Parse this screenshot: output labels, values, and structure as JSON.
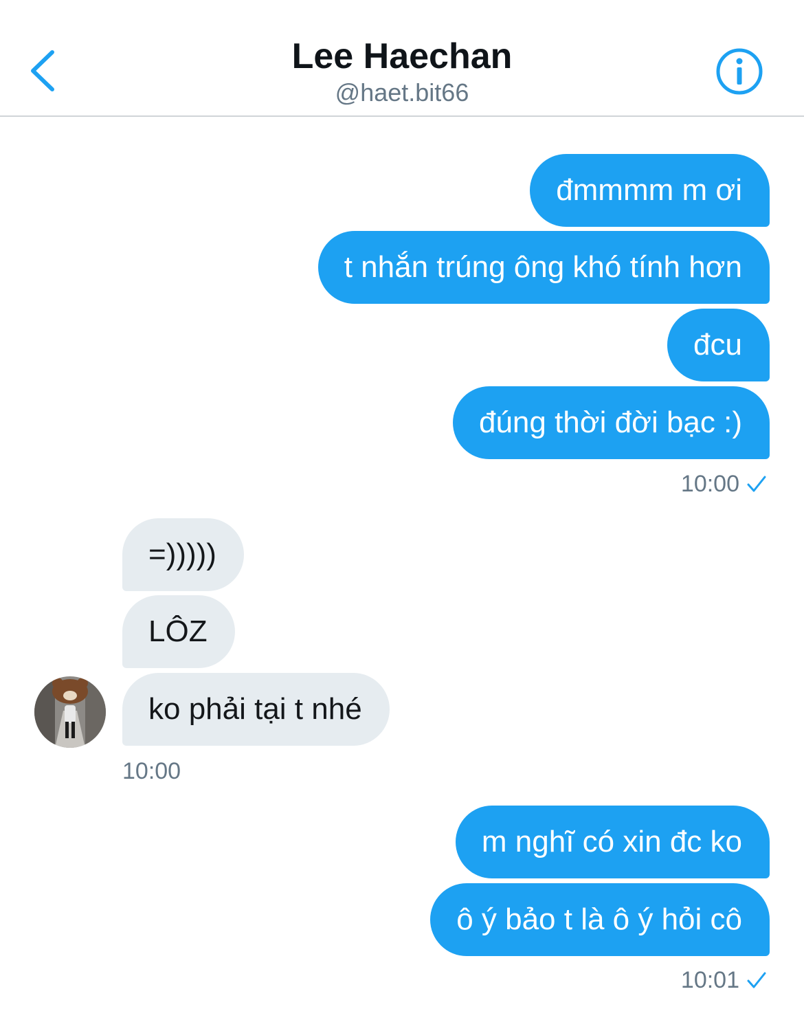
{
  "header": {
    "name": "Lee Haechan",
    "handle": "@haet.bit66",
    "back_icon": "chevron-left-icon",
    "info_icon": "info-circle-icon"
  },
  "colors": {
    "accent": "#1da1f2",
    "received_bubble": "#e6ecf0",
    "muted_text": "#657786"
  },
  "messages": {
    "group1": {
      "m1": "đmmmm m ơi",
      "m2": "t nhắn trúng ông khó tính hơn",
      "m3": "đcu",
      "m4": "đúng thời đời bạc :)",
      "time": "10:00"
    },
    "group2": {
      "m1": "=)))))",
      "m2": "LÔZ",
      "m3": "ko phải tại t nhé",
      "time": "10:00"
    },
    "group3": {
      "m1": "m nghĩ có xin đc ko",
      "m2": "ô ý bảo t là ô ý hỏi cô",
      "time": "10:01"
    }
  }
}
